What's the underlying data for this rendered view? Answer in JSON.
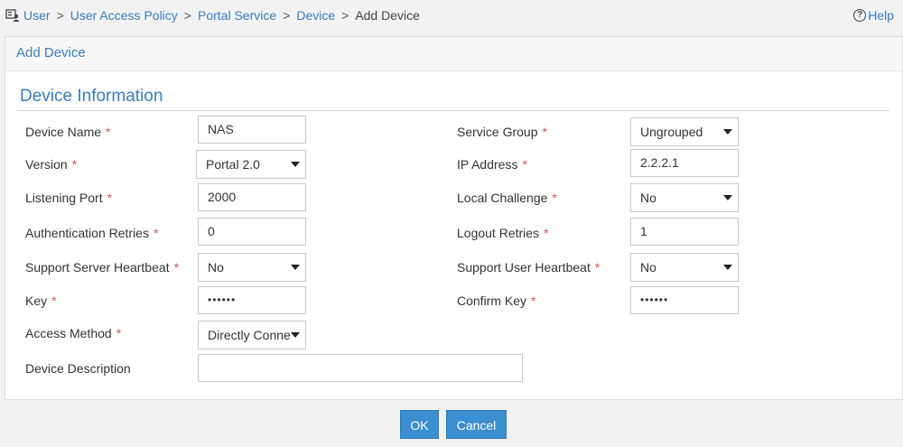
{
  "breadcrumb": {
    "items": [
      "User",
      "User Access Policy",
      "Portal Service",
      "Device"
    ],
    "separator": ">",
    "current": "Add Device"
  },
  "help": {
    "label": "Help"
  },
  "panel": {
    "title": "Add Device",
    "section_title": "Device Information"
  },
  "form": {
    "required_mark": "*",
    "device_name": {
      "label": "Device Name",
      "value": "NAS"
    },
    "version": {
      "label": "Version",
      "value": "Portal 2.0"
    },
    "listening_port": {
      "label": "Listening Port",
      "value": "2000"
    },
    "auth_retries": {
      "label": "Authentication Retries",
      "value": "0"
    },
    "server_heartbeat": {
      "label": "Support Server Heartbeat",
      "value": "No"
    },
    "key": {
      "label": "Key",
      "value": "••••••"
    },
    "access_method": {
      "label": "Access Method",
      "value": "Directly Connected"
    },
    "description": {
      "label": "Device Description",
      "value": ""
    },
    "service_group": {
      "label": "Service Group",
      "value": "Ungrouped"
    },
    "ip_address": {
      "label": "IP Address",
      "value": "2.2.2.1"
    },
    "local_challenge": {
      "label": "Local Challenge",
      "value": "No"
    },
    "logout_retries": {
      "label": "Logout Retries",
      "value": "1"
    },
    "user_heartbeat": {
      "label": "Support User Heartbeat",
      "value": "No"
    },
    "confirm_key": {
      "label": "Confirm Key",
      "value": "••••••"
    }
  },
  "buttons": {
    "ok": "OK",
    "cancel": "Cancel"
  },
  "colors": {
    "accent": "#3b7bbf",
    "button": "#3b8ed0",
    "required": "#d9534f"
  }
}
